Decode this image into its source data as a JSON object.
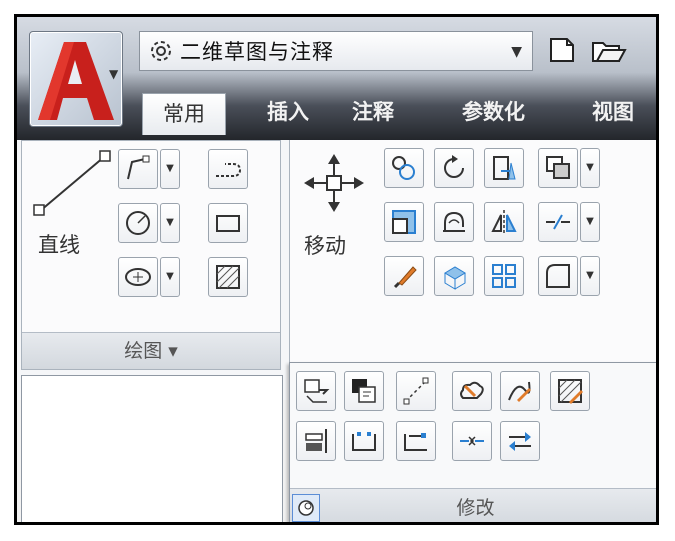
{
  "workspace": {
    "label": "二维草图与注释"
  },
  "tabs": [
    {
      "label": "常用",
      "active": true
    },
    {
      "label": "插入"
    },
    {
      "label": "注释"
    },
    {
      "label": "参数化"
    },
    {
      "label": "视图"
    }
  ],
  "draw_panel": {
    "line_label": "直线",
    "title": "绘图 ▾"
  },
  "modify_panel": {
    "move_label": "移动",
    "flyout_title": "修改"
  },
  "colors": {
    "accent_red": "#c8201c",
    "tab_dark": "#23262b",
    "ribbon_bg": "#f5f6f8"
  }
}
